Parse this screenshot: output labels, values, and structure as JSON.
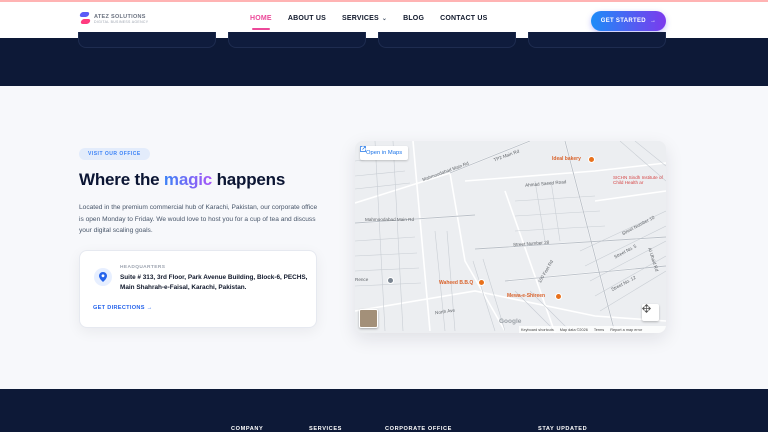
{
  "header": {
    "logo": {
      "text": "ATEZ SOLUTIONS",
      "sub": "DIGITAL BUSINESS AGENCY"
    },
    "nav": [
      {
        "label": "HOME",
        "active": true
      },
      {
        "label": "ABOUT US"
      },
      {
        "label": "SERVICES",
        "has_dropdown": true
      },
      {
        "label": "BLOG"
      },
      {
        "label": "CONTACT US"
      }
    ],
    "cta_label": "GET STARTED",
    "cta_arrow": "→",
    "dropdown_glyph": "⌄"
  },
  "visit": {
    "badge": "VISIT OUR OFFICE",
    "title_pre": "Where the ",
    "title_highlight": "magic",
    "title_post": " happens",
    "description": "Located in the premium commercial hub of Karachi, Pakistan, our corporate office is open Monday to Friday. We would love to host you for a cup of tea and discuss your digital scaling goals."
  },
  "headquarters": {
    "label": "HEADQUARTERS",
    "address": "Suite # 313, 3rd Floor, Park Avenue Building, Block-6, PECHS, Main Shahrah-e-Faisal, Karachi, Pakistan.",
    "directions_label": "GET DIRECTIONS",
    "directions_arrow": "→"
  },
  "map": {
    "open_label": "Open in Maps",
    "labels": {
      "mahmoodabad_top": "Mahmoodabad Main Rd",
      "tp2": "TP2 Main Rd",
      "mahmoodabad_left": "Mahmoodabad Main Rd",
      "ahmad_saeed": "Ahmad Saeed Road",
      "street28": "Street Number 28",
      "north_ave": "North Ave",
      "street10": "Street Number 10",
      "street12": "Street No. 12",
      "street5": "Street No. 5",
      "fence": "Rence",
      "avenue100": "100 Feet Rd",
      "aubaid": "Al Ubaid Rd"
    },
    "pois": {
      "ideal": "Ideal bakery",
      "waheed": "Waheed B.B.Q",
      "mewa": "Mewa-e-Shireen"
    },
    "sichn": "SICHN Sindh Institute of Child Health ar",
    "google": "Google",
    "attribution": {
      "shortcuts": "Keyboard shortcuts",
      "data": "Map data ©2026",
      "terms": "Terms",
      "report": "Report a map error"
    }
  },
  "footer": {
    "columns": [
      "COMPANY",
      "SERVICES",
      "CORPORATE OFFICE",
      "STAY UPDATED"
    ]
  },
  "colors": {
    "accent_pink": "#ec4899",
    "accent_blue": "#2563eb",
    "navy": "#0d1937"
  }
}
